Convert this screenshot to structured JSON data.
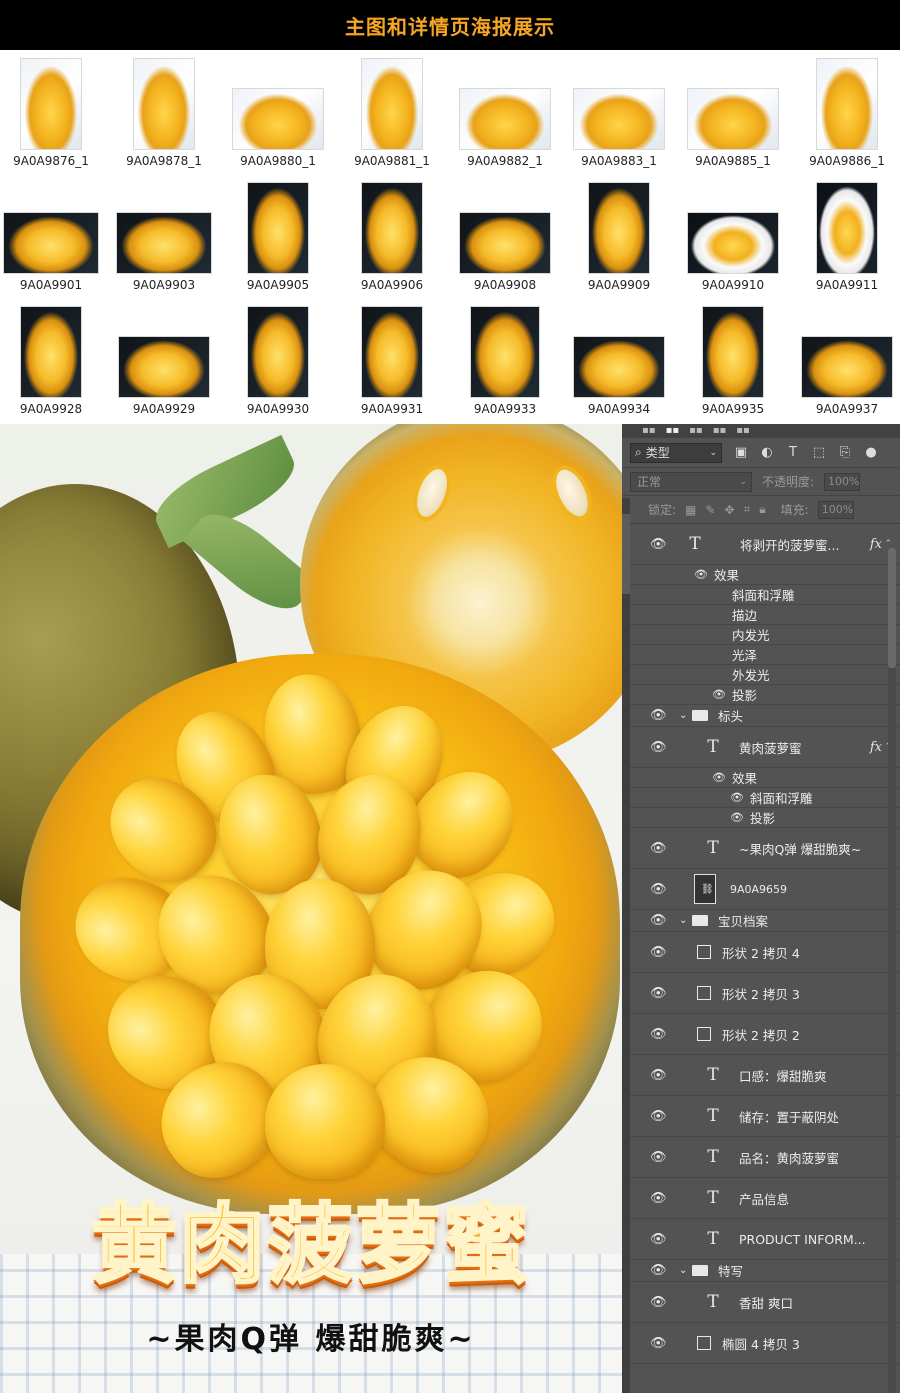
{
  "header": {
    "title": "主图和详情页海报展示"
  },
  "thumbnails": {
    "row1": [
      {
        "label": "9A0A9876_1",
        "style": "light"
      },
      {
        "label": "9A0A9878_1",
        "style": "light"
      },
      {
        "label": "9A0A9880_1",
        "style": "light"
      },
      {
        "label": "9A0A9881_1",
        "style": "light"
      },
      {
        "label": "9A0A9882_1",
        "style": "light"
      },
      {
        "label": "9A0A9883_1",
        "style": "light"
      },
      {
        "label": "9A0A9885_1",
        "style": "light"
      },
      {
        "label": "9A0A9886_1",
        "style": "light"
      }
    ],
    "row2": [
      {
        "label": "9A0A9901",
        "style": "dark"
      },
      {
        "label": "9A0A9903",
        "style": "dark"
      },
      {
        "label": "9A0A9905",
        "style": "dark"
      },
      {
        "label": "9A0A9906",
        "style": "dark"
      },
      {
        "label": "9A0A9908",
        "style": "dark"
      },
      {
        "label": "9A0A9909",
        "style": "dark"
      },
      {
        "label": "9A0A9910",
        "style": "white-plate"
      },
      {
        "label": "9A0A9911",
        "style": "white-plate"
      }
    ],
    "row3": [
      {
        "label": "9A0A9928",
        "style": "dark"
      },
      {
        "label": "9A0A9929",
        "style": "dark"
      },
      {
        "label": "9A0A9930",
        "style": "dark"
      },
      {
        "label": "9A0A9931",
        "style": "dark"
      },
      {
        "label": "9A0A9933",
        "style": "dark"
      },
      {
        "label": "9A0A9934",
        "style": "dark"
      },
      {
        "label": "9A0A9935",
        "style": "dark"
      },
      {
        "label": "9A0A9937",
        "style": "dark"
      }
    ]
  },
  "poster": {
    "title": "黄肉菠萝蜜",
    "subtitle": "~果肉Q弹 爆甜脆爽~"
  },
  "layers_panel": {
    "filter_label": "类型",
    "blend_mode": "正常",
    "opacity_label": "不透明度:",
    "opacity_value": "100%",
    "lock_label": "锁定:",
    "fill_label": "填充:",
    "fill_value": "100%",
    "layers": [
      {
        "kind": "text",
        "name": "将剥开的菠萝蜜...",
        "fx": true,
        "indent": 0
      },
      {
        "kind": "effect-header",
        "name": "效果",
        "indent": 0
      },
      {
        "kind": "effect",
        "name": "斜面和浮雕",
        "visible": false,
        "indent": 0
      },
      {
        "kind": "effect",
        "name": "描边",
        "visible": false,
        "indent": 0
      },
      {
        "kind": "effect",
        "name": "内发光",
        "visible": false,
        "indent": 0
      },
      {
        "kind": "effect",
        "name": "光泽",
        "visible": false,
        "indent": 0
      },
      {
        "kind": "effect",
        "name": "外发光",
        "visible": false,
        "indent": 0
      },
      {
        "kind": "effect",
        "name": "投影",
        "visible": true,
        "indent": 0
      },
      {
        "kind": "group",
        "name": "标头",
        "indent": 0
      },
      {
        "kind": "text",
        "name": "黄肉菠萝蜜",
        "fx": true,
        "indent": 1
      },
      {
        "kind": "effect-header",
        "name": "效果",
        "indent": 1
      },
      {
        "kind": "effect",
        "name": "斜面和浮雕",
        "visible": true,
        "indent": 1
      },
      {
        "kind": "effect",
        "name": "投影",
        "visible": true,
        "indent": 1
      },
      {
        "kind": "text",
        "name": "~果肉Q弹 爆甜脆爽~",
        "fx": false,
        "indent": 1
      },
      {
        "kind": "smart",
        "name": "9A0A9659",
        "indent": 0
      },
      {
        "kind": "group",
        "name": "宝贝档案",
        "indent": 0
      },
      {
        "kind": "shape",
        "name": "形状 2 拷贝 4",
        "indent": 1
      },
      {
        "kind": "shape",
        "name": "形状 2 拷贝 3",
        "indent": 1
      },
      {
        "kind": "shape",
        "name": "形状 2 拷贝 2",
        "indent": 1
      },
      {
        "kind": "text",
        "name": "口感：爆甜脆爽",
        "fx": false,
        "indent": 1
      },
      {
        "kind": "text",
        "name": "储存：置于蔽阴处",
        "fx": false,
        "indent": 1
      },
      {
        "kind": "text",
        "name": "品名：黄肉菠萝蜜",
        "fx": false,
        "indent": 1
      },
      {
        "kind": "text",
        "name": "产品信息",
        "fx": false,
        "indent": 1
      },
      {
        "kind": "text",
        "name": "PRODUCT    INFORM...",
        "fx": false,
        "indent": 1
      },
      {
        "kind": "group",
        "name": "特写",
        "indent": 0
      },
      {
        "kind": "text",
        "name": "香甜 爽口",
        "fx": false,
        "indent": 1
      },
      {
        "kind": "shape",
        "name": "椭圆 4 拷贝 3",
        "indent": 1
      }
    ]
  }
}
